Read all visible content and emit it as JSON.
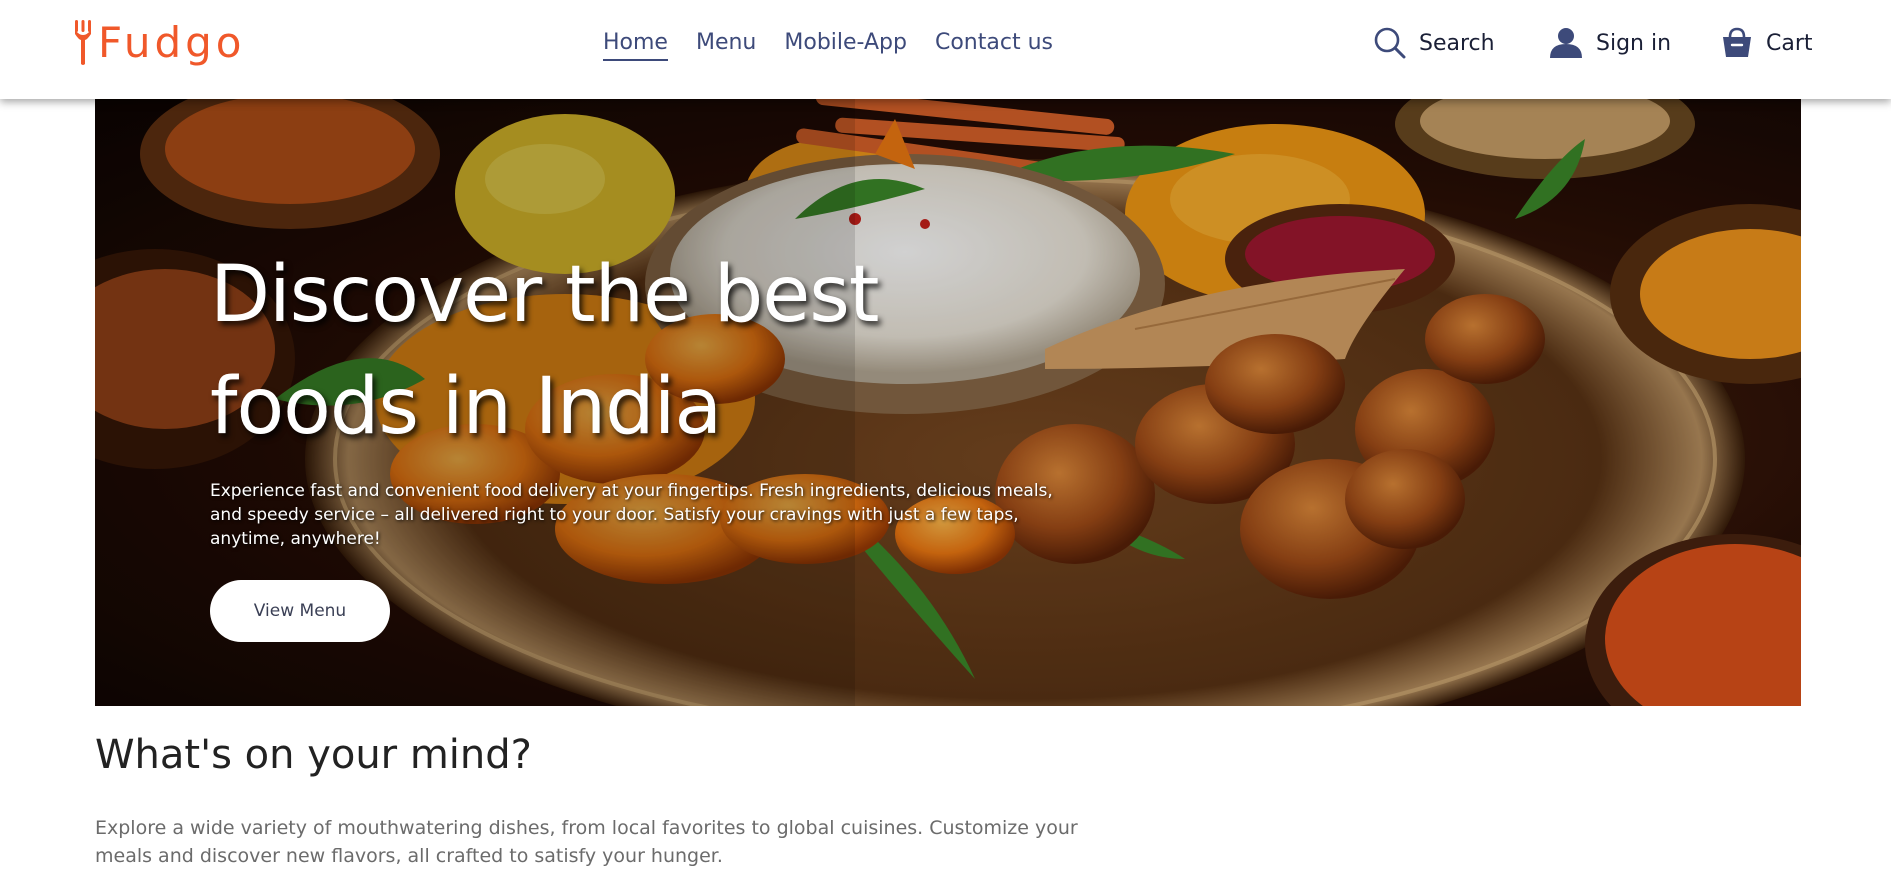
{
  "brand": {
    "name": "Fudgo",
    "color": "#f0582a"
  },
  "nav": {
    "items": [
      {
        "label": "Home",
        "active": true
      },
      {
        "label": "Menu",
        "active": false
      },
      {
        "label": "Mobile-App",
        "active": false
      },
      {
        "label": "Contact us",
        "active": false
      }
    ],
    "color": "#3d4a7a"
  },
  "actions": {
    "search": {
      "label": "Search",
      "icon": "search-icon"
    },
    "signin": {
      "label": "Sign in",
      "icon": "user-icon"
    },
    "cart": {
      "label": "Cart",
      "icon": "shopping-basket-icon"
    }
  },
  "hero": {
    "title": "Discover the best foods in India",
    "description": "Experience fast and convenient food delivery at your fingertips. Fresh ingredients, delicious meals, and speedy service – all delivered right to your door. Satisfy your cravings with just a few taps, anytime, anywhere!",
    "button_label": "View Menu"
  },
  "section": {
    "title": "What's on your mind?",
    "description": "Explore a wide variety of mouthwatering dishes, from local favorites to global cuisines. Customize your meals and discover new flavors, all crafted to satisfy your hunger."
  }
}
